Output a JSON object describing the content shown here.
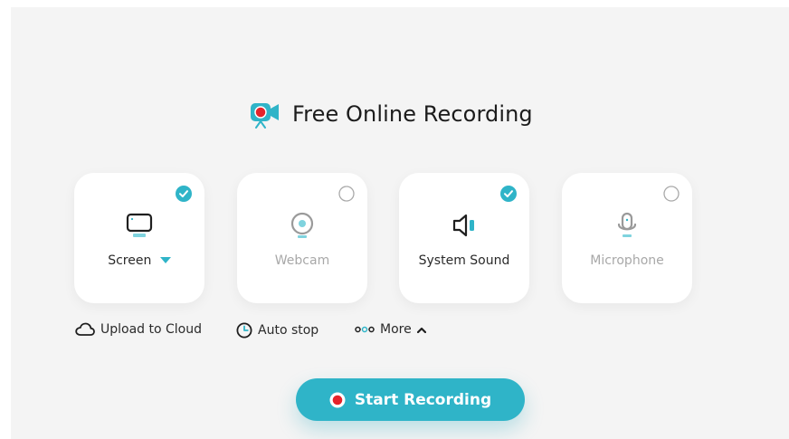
{
  "app": {
    "title": "Free Online Recording"
  },
  "sources": [
    {
      "label": "Screen",
      "selected": true,
      "icon": "monitor-icon",
      "has_dropdown": true
    },
    {
      "label": "Webcam",
      "selected": false,
      "icon": "webcam-icon"
    },
    {
      "label": "System Sound",
      "selected": true,
      "icon": "speaker-icon"
    },
    {
      "label": "Microphone",
      "selected": false,
      "icon": "microphone-icon"
    }
  ],
  "options": {
    "upload": {
      "label": "Upload to Cloud",
      "icon": "cloud-icon"
    },
    "autostop": {
      "label": "Auto stop",
      "icon": "clock-icon"
    },
    "more": {
      "label": "More",
      "icon": "dots-icon"
    }
  },
  "start_button": {
    "label": "Start Recording",
    "icon": "record-dot-icon"
  },
  "colors": {
    "accent": "#2fb4c8",
    "record_red": "#e5232b",
    "panel_bg": "#f4f4f4",
    "inactive_text": "#a8a8a8"
  }
}
